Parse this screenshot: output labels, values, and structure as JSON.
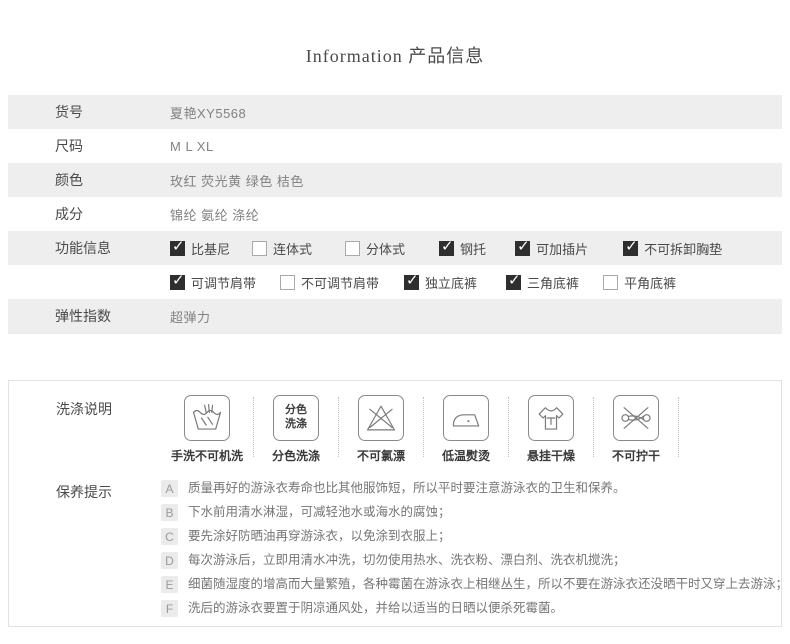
{
  "header": {
    "title": "Information 产品信息"
  },
  "product_table": {
    "rows": [
      {
        "label": "货号",
        "value": "夏艳XY5568"
      },
      {
        "label": "尺码",
        "value": "M L XL"
      },
      {
        "label": "颜色",
        "value": "玫红 荧光黄 绿色 桔色"
      },
      {
        "label": "成分",
        "value": "锦纶 氨纶 涤纶"
      }
    ],
    "features": {
      "label": "功能信息",
      "line1": [
        {
          "label": "比基尼",
          "checked": true
        },
        {
          "label": "连体式",
          "checked": false
        },
        {
          "label": "分体式",
          "checked": false
        },
        {
          "label": "钢托",
          "checked": true
        },
        {
          "label": "可加插片",
          "checked": true
        },
        {
          "label": "不可拆卸胸垫",
          "checked": true
        }
      ],
      "line2": [
        {
          "label": "可调节肩带",
          "checked": true
        },
        {
          "label": "不可调节肩带",
          "checked": false
        },
        {
          "label": "独立底裤",
          "checked": true
        },
        {
          "label": "三角底裤",
          "checked": true
        },
        {
          "label": "平角底裤",
          "checked": false
        }
      ]
    },
    "elasticity": {
      "label": "弹性指数",
      "value": "超弹力"
    }
  },
  "care_box": {
    "wash_section_label": "洗涤说明",
    "wash_icons": [
      {
        "icon": "hand-wash-icon",
        "label": "手洗不可机洗"
      },
      {
        "icon": "color-separation-wash-icon",
        "label": "分色洗涤",
        "box_text_line1": "分色",
        "box_text_line2": "洗涤"
      },
      {
        "icon": "no-bleach-icon",
        "label": "不可氯漂"
      },
      {
        "icon": "low-temp-iron-icon",
        "label": "低温熨烫"
      },
      {
        "icon": "hang-dry-icon",
        "label": "悬挂干燥"
      },
      {
        "icon": "no-wring-icon",
        "label": "不可拧干"
      }
    ],
    "tips_section_label": "保养提示",
    "tips": [
      {
        "letter": "A",
        "text": "质量再好的游泳衣寿命也比其他服饰短，所以平时要注意游泳衣的卫生和保养。"
      },
      {
        "letter": "B",
        "text": "下水前用清水淋湿，可减轻池水或海水的腐蚀；"
      },
      {
        "letter": "C",
        "text": "要先涂好防晒油再穿游泳衣，以免涂到衣服上；"
      },
      {
        "letter": "D",
        "text": "每次游泳后，立即用清水冲洗，切勿使用热水、洗衣粉、漂白剂、洗衣机搅洗；"
      },
      {
        "letter": "E",
        "text": "细菌随湿度的增高而大量繁殖，各种霉菌在游泳衣上相继丛生，所以不要在游泳衣还没晒干时又穿上去游泳；"
      },
      {
        "letter": "F",
        "text": "洗后的游泳衣要置于阴凉通风处，并给以适当的日晒以便杀死霉菌。"
      }
    ]
  },
  "colors": {
    "row_alt_bg": "#eeeeee",
    "label_text": "#4a4a4a",
    "value_text": "#828282",
    "checkbox_checked_bg": "#2e2e2e",
    "checkbox_border": "#a9a9a9",
    "care_box_border": "#e2e2e2",
    "badge_bg": "#ebebeb",
    "badge_text": "#9a9a9a",
    "icon_stroke": "#7a7a7a"
  }
}
